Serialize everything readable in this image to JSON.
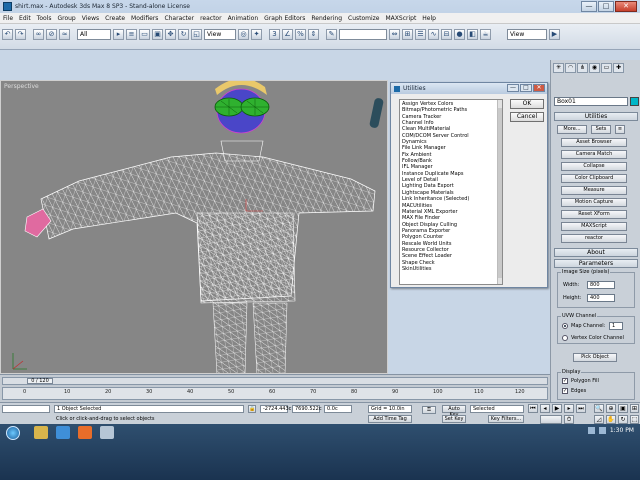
{
  "window": {
    "title": "shirt.max - Autodesk 3ds Max 8 SP3 - Stand-alone License",
    "minimize": "—",
    "maximize": "□",
    "close": "✕"
  },
  "menu": [
    "File",
    "Edit",
    "Tools",
    "Group",
    "Views",
    "Create",
    "Modifiers",
    "Character",
    "reactor",
    "Animation",
    "Graph Editors",
    "Rendering",
    "Customize",
    "MAXScript",
    "Help"
  ],
  "toolbar": {
    "selection_filter": "All",
    "reference_coord": "View",
    "view_dropdown": "View",
    "named_selection": ""
  },
  "viewport": {
    "label": "Perspective"
  },
  "utilities_dialog": {
    "title": "Utilities",
    "ok_label": "OK",
    "cancel_label": "Cancel",
    "items": [
      "Assign Vertex Colors",
      "Bitmap/Photometric Paths",
      "Camera Tracker",
      "Channel Info",
      "Clean MultiMaterial",
      "COM/DCOM Server Control",
      "Dynamics",
      "File Link Manager",
      "Fix Ambient",
      "Follow/Bank",
      "IFL Manager",
      "Instance Duplicate Maps",
      "Level of Detail",
      "Lighting Data Export",
      "Lightscape Materials",
      "Link Inheritance (Selected)",
      "MACUtilities",
      "Material XML Exporter",
      "MAX File Finder",
      "Object Display Culling",
      "Panorama Exporter",
      "Polygon Counter",
      "Rescale World Units",
      "Resource Collector",
      "Scene Effect Loader",
      "Shape Check",
      "SkinUtilities"
    ]
  },
  "command_panel": {
    "object_name": "Box01",
    "object_color": "#00b7c8",
    "utilities_rollout": "Utilities",
    "more_button": "More...",
    "sets_button": "Sets",
    "utility_buttons": [
      "Asset Browser",
      "Camera Match",
      "Collapse",
      "Color Clipboard",
      "Measure",
      "Motion Capture",
      "Reset XForm",
      "MAXScript",
      "reactor"
    ],
    "about_rollout": "About",
    "parameters_rollout": "Parameters",
    "image_size_label": "Image Size (pixels)",
    "width_label": "Width:",
    "width_value": "800",
    "height_label": "Height:",
    "height_value": "400",
    "uvw_channel_label": "UVW Channel",
    "map_channel_label": "Map Channel:",
    "map_channel_value": "1",
    "vertex_color_label": "Vertex Color Channel",
    "pick_object_button": "Pick Object",
    "display_label": "Display",
    "polygon_fill_label": "Polygon Fill",
    "edges_label": "Edges"
  },
  "timeline": {
    "frame_display": "0 / 120",
    "ticks": [
      "0",
      "10",
      "20",
      "30",
      "40",
      "50",
      "60",
      "70",
      "80",
      "90",
      "100",
      "110",
      "120"
    ]
  },
  "status": {
    "selection_info": "1 Object Selected",
    "prompt": "Click or click-and-drag to select objects",
    "x_value": "-2724.443c",
    "y_value": "7690.522c",
    "z_value": "0.0c",
    "grid": "Grid = 10.0in",
    "add_time_tag": "Add Time Tag",
    "auto_key": "Auto Key",
    "set_key": "Set Key",
    "selected_dropdown": "Selected",
    "key_filters": "Key Filters..."
  },
  "taskbar": {
    "clock": "1:30 PM"
  }
}
